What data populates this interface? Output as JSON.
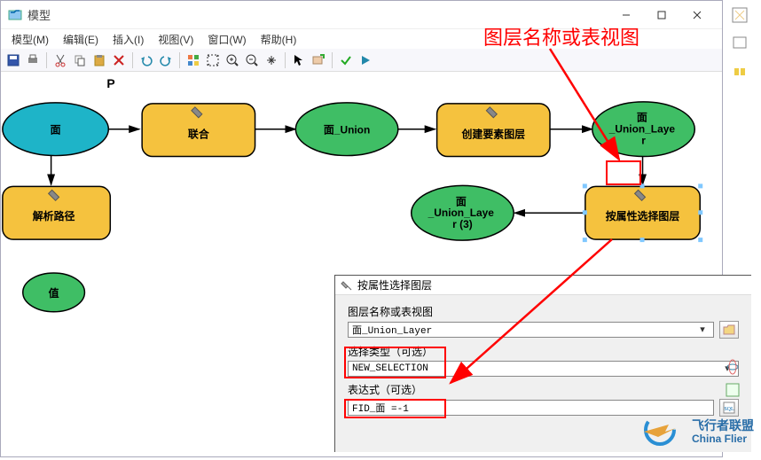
{
  "window": {
    "title": "模型",
    "controls": {
      "min": "–",
      "max": "□",
      "close": "×"
    }
  },
  "menubar": {
    "items": [
      "模型(M)",
      "编辑(E)",
      "插入(I)",
      "视图(V)",
      "窗口(W)",
      "帮助(H)"
    ]
  },
  "toolbar": {
    "icons": [
      "save",
      "print",
      "cut",
      "copy",
      "paste",
      "delete",
      "undo",
      "redo",
      "grid",
      "fit",
      "zoomin",
      "zoomout",
      "pan",
      "select",
      "pen",
      "run",
      "validate"
    ]
  },
  "canvas": {
    "param_label": "P",
    "nodes": {
      "mian": "面",
      "lianhe": "联合",
      "union": "面_Union",
      "create": "创建要素图层",
      "layer": "面\n_Union_Laye\nr",
      "jiexi": "解析路径",
      "layer3": "面\n_Union_Laye\nr (3)",
      "select": "按属性选择图层",
      "zhi": "值"
    }
  },
  "annotation": {
    "title": "图层名称或表视图"
  },
  "dialog": {
    "title": "按属性选择图层",
    "label1": "图层名称或表视图",
    "input1": "面_Union_Layer",
    "label2": "选择类型（可选）",
    "input2": "NEW_SELECTION",
    "label3": "表达式（可选）",
    "input3": "FID_面 =-1"
  },
  "watermark": {
    "line1": "飞行者联盟",
    "line2": "China Flier"
  }
}
